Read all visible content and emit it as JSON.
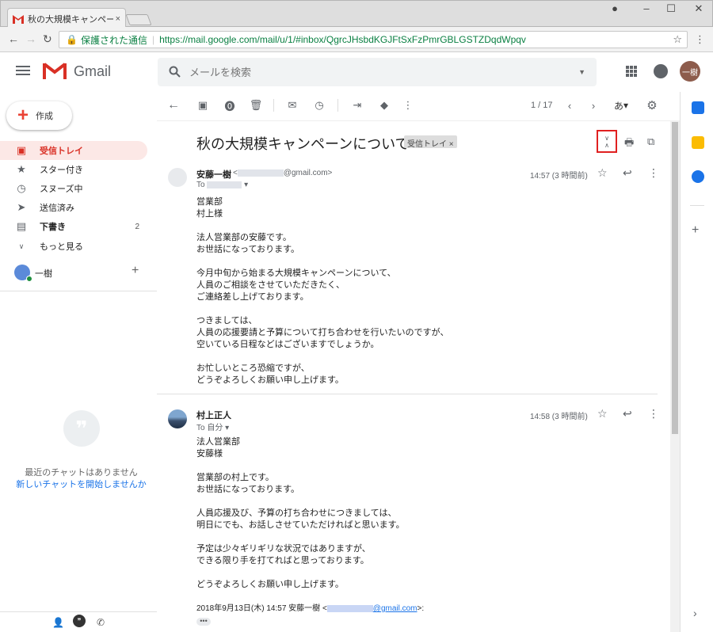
{
  "browser": {
    "tab_title": "秋の大規模キャンペーンについて",
    "tab_close": "×",
    "secure_label": "保護された通信",
    "url": "https://mail.google.com/mail/u/1/#inbox/QgrcJHsbdKGJFtSxFzPmrGBLGSTZDqdWpqv"
  },
  "header": {
    "app_name": "Gmail",
    "search_placeholder": "メールを検索",
    "avatar_text": "一樹"
  },
  "sidebar": {
    "compose_label": "作成",
    "items": [
      {
        "label": "受信トレイ",
        "icon": "inbox-icon",
        "active": true,
        "count": ""
      },
      {
        "label": "スター付き",
        "icon": "star-icon",
        "active": false,
        "count": ""
      },
      {
        "label": "スヌーズ中",
        "icon": "clock-icon",
        "active": false,
        "count": ""
      },
      {
        "label": "送信済み",
        "icon": "send-icon",
        "active": false,
        "count": ""
      },
      {
        "label": "下書き",
        "icon": "draft-icon",
        "active": false,
        "count": "2"
      },
      {
        "label": "もっと見る",
        "icon": "chevron-down-icon",
        "active": false,
        "count": ""
      }
    ],
    "account_name": "一樹",
    "no_chat": "最近のチャットはありません",
    "new_chat": "新しいチャットを開始しませんか"
  },
  "toolbar": {
    "pager": "1 / 17",
    "input_tool": "あ"
  },
  "thread": {
    "subject": "秋の大規模キャンペーンについて",
    "label": "受信トレイ",
    "label_x": "×",
    "messages": [
      {
        "sender": "安藤一樹",
        "email_prefix": "<",
        "email_suffix": "@gmail.com>",
        "to": "To",
        "time": "14:57 (3 時間前)",
        "body": "営業部\n村上様\n\n法人営業部の安藤です。\nお世話になっております。\n\n今月中旬から始まる大規模キャンペーンについて、\n人員のご相談をさせていただきたく、\nご連絡差し上げております。\n\nつきましては、\n人員の応援要請と予算について打ち合わせを行いたいのですが、\n空いている日程などはございますでしょうか。\n\nお忙しいところ恐縮ですが、\nどうぞよろしくお願い申し上げます。"
      },
      {
        "sender": "村上正人",
        "to": "To 自分",
        "time": "14:58 (3 時間前)",
        "body": "法人営業部\n安藤様\n\n営業部の村上です。\nお世話になっております。\n\n人員応援及び、予算の打ち合わせにつきましては、\n明日にでも、お話しさせていただければと思います。\n\n予定は少々ギリギリな状況ではありますが、\nできる限り手を打てればと思っております。\n\nどうぞよろしくお願い申し上げます。",
        "quote_prefix": "2018年9月13日(木) 14:57 安藤一樹 <",
        "quote_link": "@gmail.com",
        "quote_suffix": ">:",
        "ellipsis": "•••"
      }
    ]
  },
  "colors": {
    "accent": "#d93025",
    "active_bg": "#fce8e6",
    "link": "#1a73e8",
    "secure": "#0b8043"
  }
}
